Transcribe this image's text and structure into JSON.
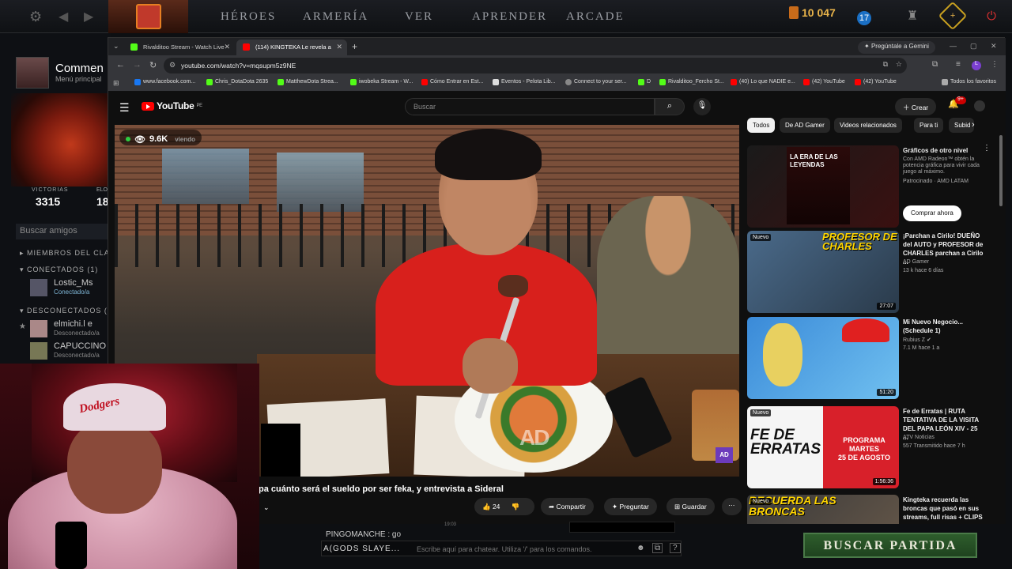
{
  "dota": {
    "nav": [
      "HÉROES",
      "ARMERÍA",
      "VER",
      "APRENDER",
      "ARCADE"
    ],
    "gold": "10 047",
    "level": "17",
    "user": {
      "name": "Commen",
      "menu": "Menú principal"
    },
    "stats": {
      "victorias_label": "VICTORIAS",
      "victorias": "3315",
      "elo_label": "ELO",
      "elo": "18"
    },
    "search_friends": "Buscar amigos",
    "sections": {
      "miembros": "MIEMBROS DEL CLA",
      "conectados": "CONECTADOS (1)",
      "desconectados": "DESCONECTADOS ("
    },
    "friends": [
      {
        "name": "Lostic_Ms",
        "status": "Conectado/a"
      },
      {
        "name": "elmichi.l e",
        "status": "Desconectado/a"
      },
      {
        "name": "CAPUCCINO",
        "status": "Desconectado/a"
      }
    ],
    "chat_message": "PINGOMANCHE : go",
    "chat_time": "19:03",
    "chat_channel": "A(GODS SLAYE...",
    "chat_placeholder": "Escribe aquí para chatear. Utiliza '/' para los comandos.",
    "find_match": "BUSCAR PARTIDA"
  },
  "browser": {
    "tabs": [
      {
        "title": "Rivalditoo Stream - Watch Live",
        "active": false
      },
      {
        "title": "(114) KINGTEKA Le revela a",
        "active": true
      }
    ],
    "gemini": "Pregúntale a Gemini",
    "url": "youtube.com/watch?v=mqsupm5z9NE",
    "bookmarks": [
      "www.facebook.com...",
      "Chris_DotaDota 2635",
      "MatthewDota Strea...",
      "iwobeka Stream - W...",
      "Cómo Entrar en Est...",
      "Eventos - Pelota Lib...",
      "Connect to your ser...",
      "D",
      "Rivalditoo_Fercho St...",
      "(40) Lo que NADIE e...",
      "(42) YouTube",
      "(42) YouTube"
    ],
    "all_bookmarks": "Todos los favoritos"
  },
  "youtube": {
    "logo": "YouTube",
    "logo_region": "PE",
    "search_placeholder": "Buscar",
    "create": "Crear",
    "notif_badge": "9+",
    "video": {
      "live_viewers": "9.6K",
      "viewers_label": "viendo",
      "title": "pa cuánto será el sueldo por ser feka, y entrevista a Sideral",
      "likes": "24",
      "share": "Compartir",
      "ask": "Preguntar",
      "save": "Guardar"
    },
    "chips": [
      "Todos",
      "De AD Gamer",
      "Videos relacionados",
      "Para ti",
      "Subid"
    ],
    "recs": [
      {
        "title": "Gráficos de otro nivel",
        "channel": "Con AMD Radeon™ obtén la potencia gráfica para vivir cada juego al máximo.",
        "meta": "Patrocinado · AMD LATAM",
        "cta": "Comprar ahora",
        "duration": "",
        "new": false,
        "thumb_text": "LA ERA DE LAS LEYENDAS"
      },
      {
        "title": "¡Parchan a Cirilo! DUEÑO del AUTO y PROFESOR de CHARLES parchan a Cirilo ...",
        "channel": "AD Gamer",
        "meta": "13 k  hace 6 días",
        "duration": "27:07",
        "new": true,
        "thumb_text": "PROFESOR DE CHARLES"
      },
      {
        "title": "Mi Nuevo Negocio... (Schedule 1)",
        "channel": "Rubius Z",
        "meta": "7.1 M  hace 1 a",
        "duration": "51:20",
        "new": false,
        "thumb_text": ""
      },
      {
        "title": "Fe de Erratas | RUTA TENTATIVA DE LA VISITA DEL PAPA LEÓN XIV - 25 ...",
        "channel": "ATV Noticias",
        "meta": "557  Transmitido hace 7 h",
        "duration": "1:56:36",
        "new": true,
        "thumb_text": "FE DE ERRATAS"
      },
      {
        "title": "Kingteka recuerda las broncas que pasó en sus streams, full risas + CLIPS",
        "channel": "",
        "meta": "",
        "duration": "",
        "new": true,
        "thumb_text": "RECUERDA LAS BRONCAS"
      }
    ]
  },
  "webcam": {
    "cap_text": "Dodgers"
  }
}
